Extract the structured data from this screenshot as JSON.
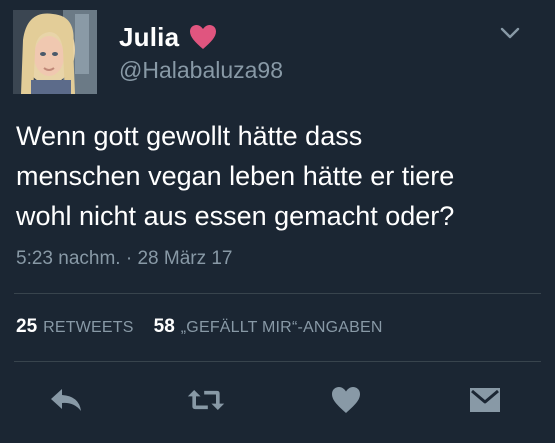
{
  "user": {
    "display_name": "Julia",
    "handle": "@Halabaluza98"
  },
  "tweet": {
    "lines": [
      "Wenn gott gewollt hätte dass",
      "menschen vegan leben hätte er tiere",
      "wohl nicht aus essen gemacht oder?"
    ],
    "timestamp": "5:23 nachm. · 28 März 17"
  },
  "stats": {
    "retweets_count": "25",
    "retweets_label": "RETWEETS",
    "likes_count": "58",
    "likes_label": "„GEFÄLLT MIR“-ANGABEN"
  },
  "colors": {
    "background": "#1b2633",
    "primary_text": "#ffffff",
    "secondary_text": "#8899a6",
    "heart_badge": "#e0557f",
    "divider": "#38444d",
    "action_icon": "#8899a6"
  },
  "icons": {
    "name_badge": "heart-icon",
    "menu": "chevron-down-icon",
    "actions": [
      "reply-icon",
      "retweet-icon",
      "like-icon",
      "direct-message-icon"
    ]
  }
}
